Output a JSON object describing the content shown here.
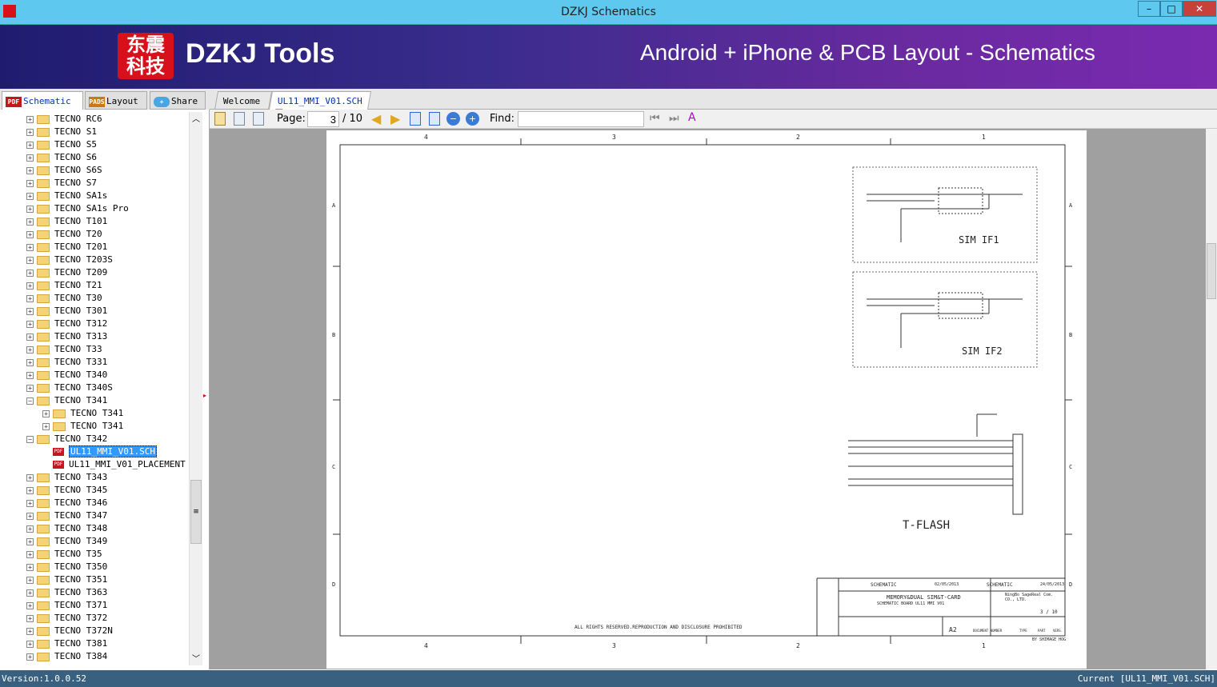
{
  "window": {
    "title": "DZKJ Schematics",
    "buttons": [
      "minimize",
      "maximize",
      "close"
    ]
  },
  "banner": {
    "logo_text": "东震科技",
    "brand": "DZKJ Tools",
    "slogan": "Android + iPhone & PCB Layout - Schematics"
  },
  "left_tabs": [
    {
      "label": "Schematic",
      "icon": "pdf-icon"
    },
    {
      "label": "Layout",
      "icon": "pads-icon"
    },
    {
      "label": "Share",
      "icon": "cloud-share-icon"
    }
  ],
  "doc_tabs": [
    {
      "label": "Welcome"
    },
    {
      "label": "UL11_MMI_V01.SCH"
    }
  ],
  "tree": [
    {
      "label": "TECNO RC6",
      "level": 0,
      "type": "folder",
      "state": "collapsed"
    },
    {
      "label": "TECNO S1",
      "level": 0,
      "type": "folder",
      "state": "collapsed"
    },
    {
      "label": "TECNO S5",
      "level": 0,
      "type": "folder",
      "state": "collapsed"
    },
    {
      "label": "TECNO S6",
      "level": 0,
      "type": "folder",
      "state": "collapsed"
    },
    {
      "label": "TECNO S6S",
      "level": 0,
      "type": "folder",
      "state": "collapsed"
    },
    {
      "label": "TECNO S7",
      "level": 0,
      "type": "folder",
      "state": "collapsed"
    },
    {
      "label": "TECNO SA1s",
      "level": 0,
      "type": "folder",
      "state": "collapsed"
    },
    {
      "label": "TECNO SA1s Pro",
      "level": 0,
      "type": "folder",
      "state": "collapsed"
    },
    {
      "label": "TECNO T101",
      "level": 0,
      "type": "folder",
      "state": "collapsed"
    },
    {
      "label": "TECNO T20",
      "level": 0,
      "type": "folder",
      "state": "collapsed"
    },
    {
      "label": "TECNO T201",
      "level": 0,
      "type": "folder",
      "state": "collapsed"
    },
    {
      "label": "TECNO T203S",
      "level": 0,
      "type": "folder",
      "state": "collapsed"
    },
    {
      "label": "TECNO T209",
      "level": 0,
      "type": "folder",
      "state": "collapsed"
    },
    {
      "label": "TECNO T21",
      "level": 0,
      "type": "folder",
      "state": "collapsed"
    },
    {
      "label": "TECNO T30",
      "level": 0,
      "type": "folder",
      "state": "collapsed"
    },
    {
      "label": "TECNO T301",
      "level": 0,
      "type": "folder",
      "state": "collapsed"
    },
    {
      "label": "TECNO T312",
      "level": 0,
      "type": "folder",
      "state": "collapsed"
    },
    {
      "label": "TECNO T313",
      "level": 0,
      "type": "folder",
      "state": "collapsed"
    },
    {
      "label": "TECNO T33",
      "level": 0,
      "type": "folder",
      "state": "collapsed"
    },
    {
      "label": "TECNO T331",
      "level": 0,
      "type": "folder",
      "state": "collapsed"
    },
    {
      "label": "TECNO T340",
      "level": 0,
      "type": "folder",
      "state": "collapsed"
    },
    {
      "label": "TECNO T340S",
      "level": 0,
      "type": "folder",
      "state": "collapsed"
    },
    {
      "label": "TECNO T341",
      "level": 0,
      "type": "folder",
      "state": "expanded"
    },
    {
      "label": "TECNO T341",
      "level": 1,
      "type": "folder",
      "state": "collapsed"
    },
    {
      "label": "TECNO T341",
      "level": 1,
      "type": "folder",
      "state": "collapsed"
    },
    {
      "label": "TECNO T342",
      "level": 0,
      "type": "folder",
      "state": "expanded"
    },
    {
      "label": "UL11_MMI_V01.SCH",
      "level": 1,
      "type": "pdf",
      "state": "selected"
    },
    {
      "label": "UL11_MMI_V01_PLACEMENT",
      "level": 1,
      "type": "pdf",
      "state": ""
    },
    {
      "label": "TECNO T343",
      "level": 0,
      "type": "folder",
      "state": "collapsed"
    },
    {
      "label": "TECNO T345",
      "level": 0,
      "type": "folder",
      "state": "collapsed"
    },
    {
      "label": "TECNO T346",
      "level": 0,
      "type": "folder",
      "state": "collapsed"
    },
    {
      "label": "TECNO T347",
      "level": 0,
      "type": "folder",
      "state": "collapsed"
    },
    {
      "label": "TECNO T348",
      "level": 0,
      "type": "folder",
      "state": "collapsed"
    },
    {
      "label": "TECNO T349",
      "level": 0,
      "type": "folder",
      "state": "collapsed"
    },
    {
      "label": "TECNO T35",
      "level": 0,
      "type": "folder",
      "state": "collapsed"
    },
    {
      "label": "TECNO T350",
      "level": 0,
      "type": "folder",
      "state": "collapsed"
    },
    {
      "label": "TECNO T351",
      "level": 0,
      "type": "folder",
      "state": "collapsed"
    },
    {
      "label": "TECNO T363",
      "level": 0,
      "type": "folder",
      "state": "collapsed"
    },
    {
      "label": "TECNO T371",
      "level": 0,
      "type": "folder",
      "state": "collapsed"
    },
    {
      "label": "TECNO T372",
      "level": 0,
      "type": "folder",
      "state": "collapsed"
    },
    {
      "label": "TECNO T372N",
      "level": 0,
      "type": "folder",
      "state": "collapsed"
    },
    {
      "label": "TECNO T381",
      "level": 0,
      "type": "folder",
      "state": "collapsed"
    },
    {
      "label": "TECNO T384",
      "level": 0,
      "type": "folder",
      "state": "collapsed"
    }
  ],
  "toolbar": {
    "page_label": "Page:",
    "page_value": "3",
    "page_total": "/ 10",
    "find_label": "Find:",
    "find_value": ""
  },
  "schematic": {
    "col_labels": [
      "4",
      "3",
      "2",
      "1"
    ],
    "row_labels": [
      "A",
      "B",
      "C",
      "D"
    ],
    "sim1_label": "SIM IF1",
    "sim2_label": "SIM IF2",
    "tflash_label": "T-FLASH",
    "copyright": "ALL RIGHTS RESERVED.REPRODUCTION AND DISCLOSURE PROHIBITED",
    "title_block": {
      "modified_name": "SCHEMATIC",
      "modified_date": "02/05/2013",
      "checked_name": "SCHEMATIC",
      "checked_date": "24/05/2013",
      "title": "MEMORY&DUAL SIM&T-CARD",
      "product_name": "SCHEMATIC BOARD UL11 MMI V01",
      "company": "NingBo SageReal Com. CO., LTD.",
      "page_sheet": "3 / 10",
      "format_size": "A2",
      "document_number_label": "DOCUMENT NUMBER",
      "type_label": "TYPE",
      "part_label": "PART",
      "vers_label": "VERS.",
      "by": "BY SHIMAGE HOG"
    }
  },
  "status": {
    "version": "Version:1.0.0.52",
    "current": "Current [UL11_MMI_V01.SCH]"
  }
}
